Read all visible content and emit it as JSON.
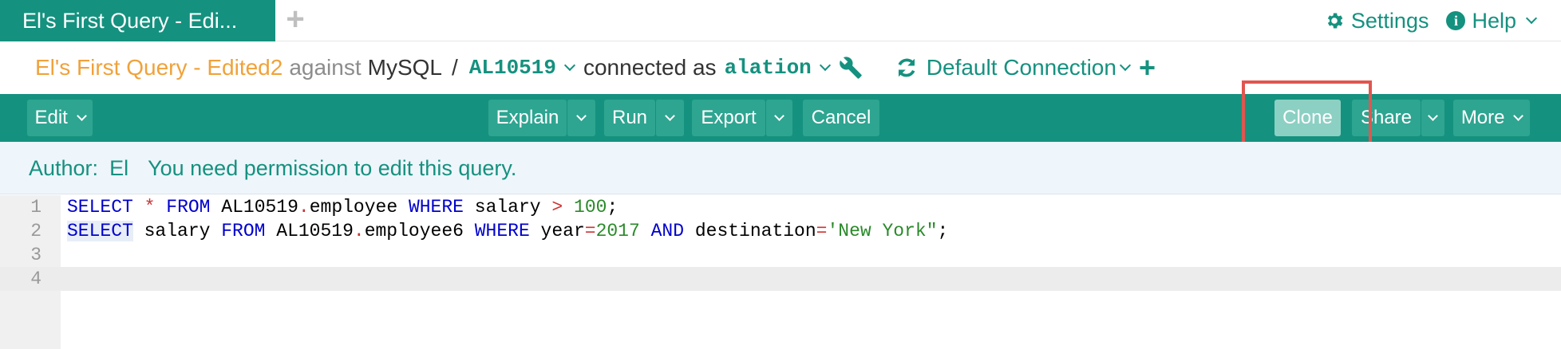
{
  "tab": {
    "title": "El's First Query - Edi..."
  },
  "top_nav": {
    "settings_label": "Settings",
    "help_label": "Help"
  },
  "context": {
    "query_name": "El's First Query - Edited2",
    "against": "against",
    "database": "MySQL",
    "slash": "/",
    "schema": "AL10519",
    "connected_as": "connected as",
    "user": "alation",
    "connection": "Default Connection"
  },
  "toolbar": {
    "edit_label": "Edit",
    "explain_label": "Explain",
    "run_label": "Run",
    "export_label": "Export",
    "cancel_label": "Cancel",
    "clone_label": "Clone",
    "share_label": "Share",
    "more_label": "More"
  },
  "banner": {
    "author_label": "Author:",
    "author_name": "El",
    "message": "You need permission to edit this query."
  },
  "editor": {
    "line_numbers": [
      "1",
      "2",
      "3",
      "4"
    ],
    "line1": {
      "t1": "SELECT",
      "t2": " ",
      "t3": "*",
      "t4": " ",
      "t5": "FROM",
      "t6": " AL10519",
      "t7": ".",
      "t8": "employee ",
      "t9": "WHERE",
      "t10": " salary ",
      "t11": ">",
      "t12": " ",
      "t13": "100",
      "t14": ";"
    },
    "line2": {
      "t1": "SELECT",
      "t2": " salary ",
      "t3": "FROM",
      "t4": " AL10519",
      "t5": ".",
      "t6": "employee6 ",
      "t7": "WHERE",
      "t8": " year",
      "t9": "=",
      "t10": "2017",
      "t11": " ",
      "t12": "AND",
      "t13": " destination",
      "t14": "=",
      "t15": "'New York\"",
      "t16": ";"
    }
  },
  "colors": {
    "accent": "#15917f",
    "query_name": "#f0a23a",
    "highlight_box": "#e0564f",
    "banner_bg": "#eef5fb"
  }
}
